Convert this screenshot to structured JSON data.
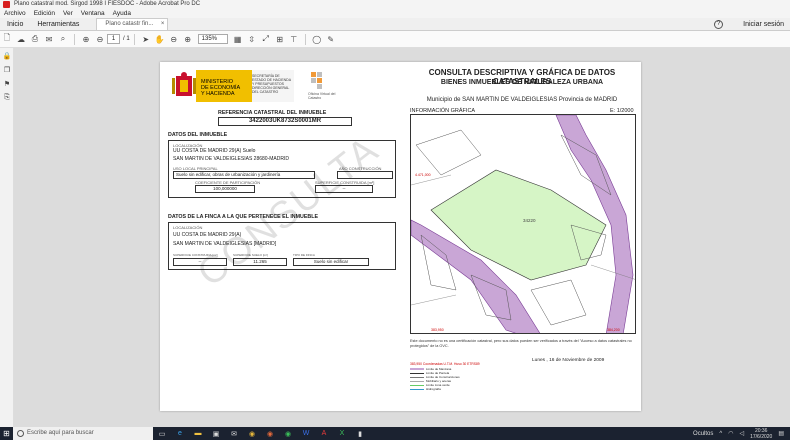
{
  "window": {
    "title": "Plano catastral mod. Sirgod 1998 I FIESDOC - Adobe Acrobat Pro DC"
  },
  "menu": [
    "Archivo",
    "Edición",
    "Ver",
    "Ventana",
    "Ayuda"
  ],
  "tabs": {
    "home": "Inicio",
    "tools": "Herramientas",
    "document": "Plano catastr fin...",
    "signin": "Iniciar sesión"
  },
  "toolbar": {
    "page_current": "1",
    "page_total": "/ 1",
    "zoom": "135%"
  },
  "document": {
    "ministry": "MINISTERIO DE ECONOMÍA Y HACIENDA",
    "secretary": "SECRETARÍA DE ESTADO DE HACIENDA Y PRESUPUESTOS",
    "direction": "DIRECCIÓN GENERAL DEL CATASTRO",
    "office": "Oficina Virtual del Catastro",
    "title1": "CONSULTA DESCRIPTIVA Y GRÁFICA DE DATOS CATASTRALES",
    "title2": "BIENES INMUEBLES DE NATURALEZA URBANA",
    "municipality": "Municipio de SAN MARTIN DE VALDEIGLESIAS Provincia de MADRID",
    "graphic_info": "INFORMACIÓN GRÁFICA",
    "scale": "E: 1/2000",
    "ref_title": "REFERENCIA CATASTRAL DEL INMUEBLE",
    "ref_value": "3422003UK8732S0001MR",
    "property_title": "DATOS DEL INMUEBLE",
    "location_label": "LOCALIZACIÓN",
    "location_1": "UU COSTA DE MADRID 29(A) Suelo",
    "location_2": "SAN MARTIN DE VALDEIGLESIAS 28680-MADRID",
    "use_label": "USO LOCAL PRINCIPAL",
    "use_value": "Suelo sin edificar, obras de urbanización y jardinería",
    "year_label": "AÑO CONSTRUCCIÓN",
    "coef_label": "COEFICIENTE DE PARTICIPACIÓN",
    "coef_value": "100,000000",
    "built_label": "SUPERFICIE CONSTRUIDA [m²]",
    "built_value": "--",
    "farm_title": "DATOS DE LA FINCA A LA QUE PERTENECE EL INMUEBLE",
    "farm_loc_1": "UU COSTA DE MADRID 29(A)",
    "farm_loc_2": "SAN MARTIN DE VALDEIGLESIAS [MADRID]",
    "farm_c1_label": "SUPERFICIE CONSTRUIDA [m²]",
    "farm_c1": "--",
    "farm_c2_label": "SUPERFICIE SUELO [m²]",
    "farm_c2": "11.265",
    "farm_c3_label": "TIPO DE FINCA",
    "farm_c3": "Suelo sin edificar",
    "watermark": "CONSULTA",
    "parcel_number": "34220",
    "coord_1": "383,950",
    "coord_2": "4.471,000",
    "coord_3": "384,200",
    "note": "Este documento no es una certificación catastral, pero sus datos pueden ser verificados a través del \"Acceso a datos catastrales no protegidos\" de la OVC.",
    "date": "Lunes , 16 de Noviembre de 2009",
    "legend": [
      "Limite de Manzana",
      "Limite de Parcela",
      "Limite de Construcciones",
      "Mobiliario y aceras",
      "Limite zona verde",
      "Hidrografía"
    ],
    "legend_head": "383,950 Coordenadas U.T.M. Huso 30 ETRS89"
  },
  "taskbar": {
    "search": "Escribe aquí para buscar",
    "weather": "Ocultos",
    "time": "20:36",
    "date": "17/6/2020"
  },
  "colors": {
    "parcel": "#d6f5c6",
    "street": "#c9a6d6"
  }
}
